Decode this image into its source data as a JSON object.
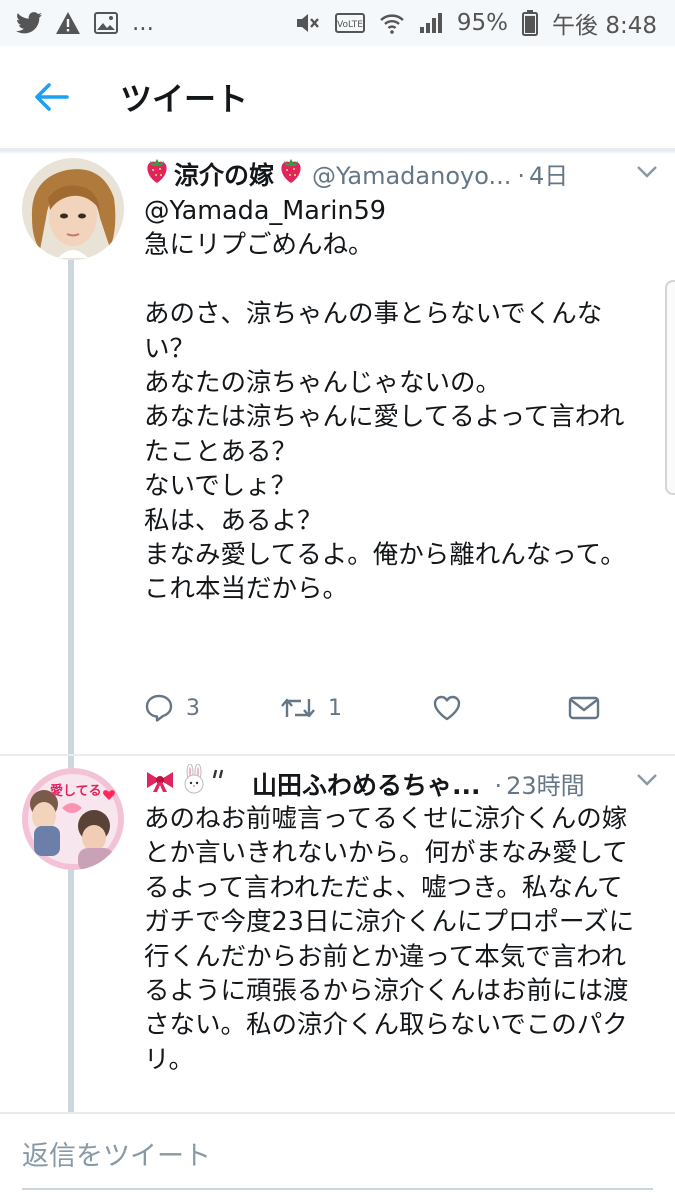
{
  "status_bar": {
    "left_icons": [
      "twitter-icon",
      "warning-icon",
      "image-icon"
    ],
    "ellipsis": "...",
    "right_icons": [
      "mute-icon",
      "volte-icon",
      "wifi-icon",
      "signal-icon"
    ],
    "volte": "VoLTE",
    "battery_percent": "95%",
    "battery_level": 0.95,
    "time": "午後 8:48"
  },
  "header": {
    "title": "ツイート"
  },
  "tweets": [
    {
      "name": "涼介の嫁",
      "handle": "@Yamadanoyo...",
      "dot": "·",
      "time": "4日",
      "text": "@Yamada_Marin59\n急にリプごめんね。\n\nあのさ、涼ちゃんの事とらないでくんない？\nあなたの涼ちゃんじゃないの。\nあなたは涼ちゃんに愛してるよって言われたことある？\nないでしょ？\n私は、あるよ？\nまなみ愛してるよ。俺から離れんなって。\nこれ本当だから。",
      "reply_count": "3",
      "retweet_count": "1",
      "like_count": "",
      "accent_color": "#e0245e"
    },
    {
      "name": "山田ふわめるちゃ...",
      "dot": "·",
      "time": "23時間",
      "avatar_text": "愛してる",
      "text": "あのねお前嘘言ってるくせに涼介くんの嫁とか言いきれないから。何がまなみ愛してるよって言われただよ、嘘つき。私なんてガチで今度23日に涼介くんにプロポーズに行くんだからお前とか違って本気で言われるように頑張るから涼介くんはお前には渡さない。私の涼介くん取らないでこのパクリ。"
    }
  ],
  "reply_placeholder": "返信をツイート",
  "colors": {
    "twitter_blue": "#1da1f2",
    "text": "#14171a",
    "secondary": "#657786",
    "thread_line": "#ccd6dd"
  }
}
